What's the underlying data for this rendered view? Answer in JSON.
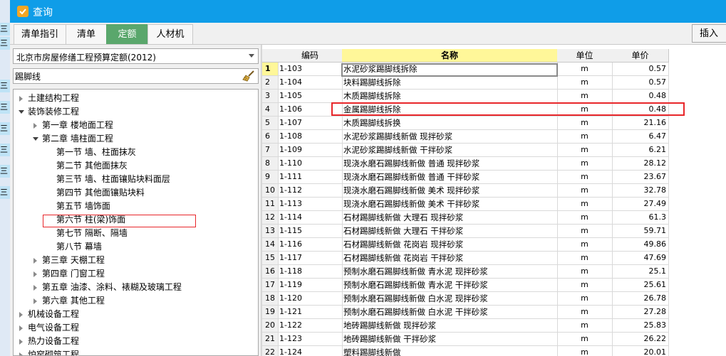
{
  "background_cells": [
    "三层",
    "三层",
    "三层",
    "三层",
    "三层",
    "三层",
    "三层",
    "三层"
  ],
  "window": {
    "title": "查询"
  },
  "tabs": [
    {
      "label": "清单指引",
      "active": false
    },
    {
      "label": "清单",
      "active": false
    },
    {
      "label": "定额",
      "active": true
    },
    {
      "label": "人材机",
      "active": false
    }
  ],
  "toolbar": {
    "insert_label": "插入"
  },
  "left": {
    "quota_library": "北京市房屋修缮工程预算定额(2012)",
    "search_value": "踢脚线"
  },
  "tree": [
    {
      "label": "土建结构工程",
      "expand": "collapsed",
      "level": 0
    },
    {
      "label": "装饰装修工程",
      "expand": "expanded",
      "level": 0
    },
    {
      "label": "第一章 楼地面工程",
      "expand": "collapsed",
      "level": 1
    },
    {
      "label": "第二章 墙柱面工程",
      "expand": "expanded",
      "level": 1
    },
    {
      "label": "第一节 墙、柱面抹灰",
      "expand": "none",
      "level": 2
    },
    {
      "label": "第二节 其他面抹灰",
      "expand": "none",
      "level": 2
    },
    {
      "label": "第三节 墙、柱面镶贴块料面层",
      "expand": "none",
      "level": 2,
      "highlighted": true
    },
    {
      "label": "第四节 其他面镶贴块料",
      "expand": "none",
      "level": 2
    },
    {
      "label": "第五节 墙饰面",
      "expand": "none",
      "level": 2
    },
    {
      "label": "第六节 柱(梁)饰面",
      "expand": "none",
      "level": 2
    },
    {
      "label": "第七节 隔断、隔墙",
      "expand": "none",
      "level": 2
    },
    {
      "label": "第八节 幕墙",
      "expand": "none",
      "level": 2
    },
    {
      "label": "第三章 天棚工程",
      "expand": "collapsed",
      "level": 1
    },
    {
      "label": "第四章 门窗工程",
      "expand": "collapsed",
      "level": 1
    },
    {
      "label": "第五章 油漆、涂料、裱糊及玻璃工程",
      "expand": "collapsed",
      "level": 1
    },
    {
      "label": "第六章 其他工程",
      "expand": "collapsed",
      "level": 1
    },
    {
      "label": "机械设备工程",
      "expand": "collapsed",
      "level": 0
    },
    {
      "label": "电气设备工程",
      "expand": "collapsed",
      "level": 0
    },
    {
      "label": "热力设备工程",
      "expand": "collapsed",
      "level": 0
    },
    {
      "label": "炉窑砌筑工程",
      "expand": "collapsed",
      "level": 0
    }
  ],
  "grid": {
    "columns": {
      "code": "编码",
      "name": "名称",
      "unit": "单位",
      "price": "单价"
    },
    "selected_row": 1,
    "highlighted_row": 3,
    "rows": [
      {
        "n": "1",
        "code": "1-103",
        "name": "水泥砂浆踢脚线拆除",
        "unit": "m",
        "price": "0.57"
      },
      {
        "n": "2",
        "code": "1-104",
        "name": "块料踢脚线拆除",
        "unit": "m",
        "price": "0.57"
      },
      {
        "n": "3",
        "code": "1-105",
        "name": "木质踢脚线拆除",
        "unit": "m",
        "price": "0.48"
      },
      {
        "n": "4",
        "code": "1-106",
        "name": "金属踢脚线拆除",
        "unit": "m",
        "price": "0.48"
      },
      {
        "n": "5",
        "code": "1-107",
        "name": "木质踢脚线拆换",
        "unit": "m",
        "price": "21.16"
      },
      {
        "n": "6",
        "code": "1-108",
        "name": "水泥砂浆踢脚线新做 现拌砂浆",
        "unit": "m",
        "price": "6.47"
      },
      {
        "n": "7",
        "code": "1-109",
        "name": "水泥砂浆踢脚线新做 干拌砂浆",
        "unit": "m",
        "price": "6.21"
      },
      {
        "n": "8",
        "code": "1-110",
        "name": "现浇水磨石踢脚线新做 普通 现拌砂浆",
        "unit": "m",
        "price": "28.12"
      },
      {
        "n": "9",
        "code": "1-111",
        "name": "现浇水磨石踢脚线新做 普通 干拌砂浆",
        "unit": "m",
        "price": "23.67"
      },
      {
        "n": "10",
        "code": "1-112",
        "name": "现浇水磨石踢脚线新做 美术 现拌砂浆",
        "unit": "m",
        "price": "32.78"
      },
      {
        "n": "11",
        "code": "1-113",
        "name": "现浇水磨石踢脚线新做 美术 干拌砂浆",
        "unit": "m",
        "price": "27.49"
      },
      {
        "n": "12",
        "code": "1-114",
        "name": "石材踢脚线新做 大理石 现拌砂浆",
        "unit": "m",
        "price": "61.3"
      },
      {
        "n": "13",
        "code": "1-115",
        "name": "石材踢脚线新做 大理石 干拌砂浆",
        "unit": "m",
        "price": "59.71"
      },
      {
        "n": "14",
        "code": "1-116",
        "name": "石材踢脚线新做 花岗岩 现拌砂浆",
        "unit": "m",
        "price": "49.86"
      },
      {
        "n": "15",
        "code": "1-117",
        "name": "石材踢脚线新做 花岗岩 干拌砂浆",
        "unit": "m",
        "price": "47.69"
      },
      {
        "n": "16",
        "code": "1-118",
        "name": "预制水磨石踢脚线新做 青水泥 现拌砂浆",
        "unit": "m",
        "price": "25.1"
      },
      {
        "n": "17",
        "code": "1-119",
        "name": "预制水磨石踢脚线新做 青水泥 干拌砂浆",
        "unit": "m",
        "price": "25.61"
      },
      {
        "n": "18",
        "code": "1-120",
        "name": "预制水磨石踢脚线新做 白水泥 现拌砂浆",
        "unit": "m",
        "price": "26.78"
      },
      {
        "n": "19",
        "code": "1-121",
        "name": "预制水磨石踢脚线新做 白水泥 干拌砂浆",
        "unit": "m",
        "price": "27.28"
      },
      {
        "n": "20",
        "code": "1-122",
        "name": "地砖踢脚线新做 现拌砂浆",
        "unit": "m",
        "price": "25.83"
      },
      {
        "n": "21",
        "code": "1-123",
        "name": "地砖踢脚线新做 干拌砂浆",
        "unit": "m",
        "price": "26.22"
      },
      {
        "n": "22",
        "code": "1-124",
        "name": "塑料踢脚线新做",
        "unit": "m",
        "price": "20.01"
      }
    ]
  },
  "colors": {
    "title_bar": "#0f9de8",
    "active_tab": "#5aa76c",
    "highlight_box": "#e8262a",
    "name_header": "#fff799"
  }
}
